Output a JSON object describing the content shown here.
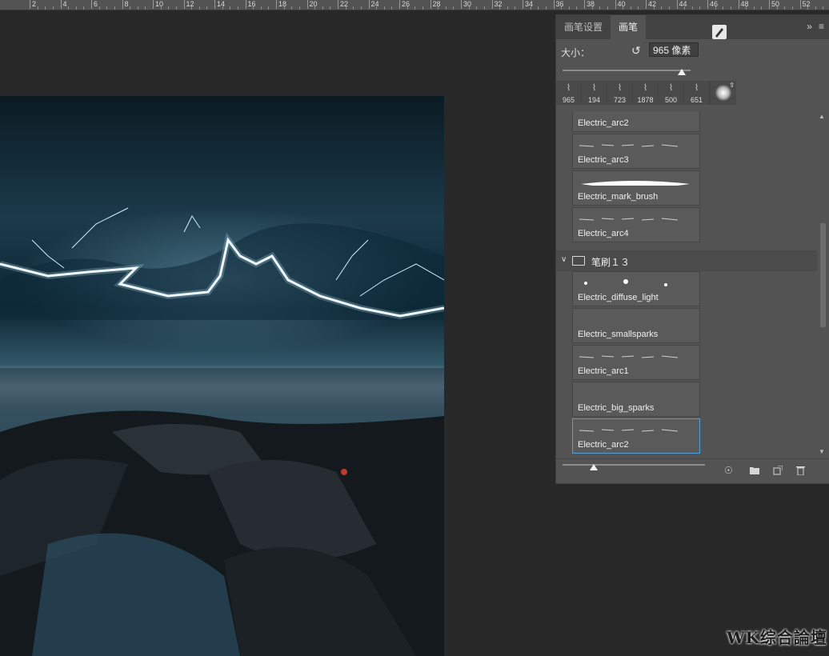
{
  "ruler": {
    "ticks": [
      "2",
      "4",
      "6",
      "8",
      "10",
      "12",
      "14",
      "16",
      "18",
      "20",
      "22",
      "24",
      "26",
      "28",
      "30",
      "32",
      "34",
      "36",
      "38",
      "40",
      "42",
      "44",
      "46",
      "48",
      "50",
      "52"
    ]
  },
  "panel": {
    "tabs": [
      {
        "label": "画笔设置"
      },
      {
        "label": "画笔"
      }
    ],
    "size_label": "大小：",
    "size_value": "965 像素",
    "size_slider_fraction": 0.93,
    "recent": [
      "965",
      "194",
      "723",
      "1878",
      "500",
      "651"
    ],
    "items_top": [
      {
        "name": "Electric_arc2"
      },
      {
        "name": "Electric_arc3"
      },
      {
        "name": "Electric_mark_brush"
      },
      {
        "name": "Electric_arc4"
      }
    ],
    "group_label": "笔刷１３",
    "items_bottom": [
      {
        "name": "Electric_diffuse_light"
      },
      {
        "name": "Electric_smallsparks"
      },
      {
        "name": "Electric_arc1"
      },
      {
        "name": "Electric_big_sparks"
      },
      {
        "name": "Electric_arc2"
      }
    ],
    "thumb_slider_fraction": 0.22
  },
  "watermark": "WK综合論壇"
}
